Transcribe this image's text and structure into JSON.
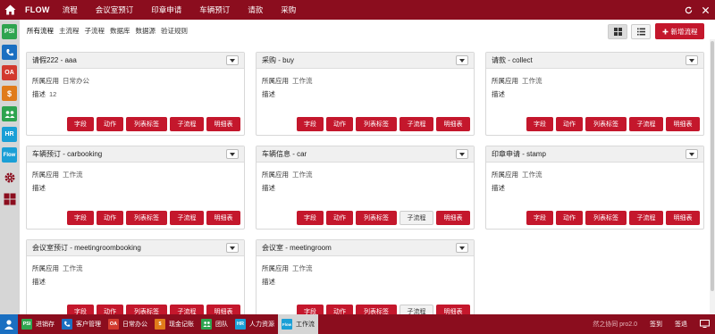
{
  "topbar": {
    "brand": "FLOW",
    "nav": [
      "流程",
      "会议室预订",
      "印章申请",
      "车辆预订",
      "请款",
      "采购"
    ]
  },
  "dock": [
    {
      "label": "PSI",
      "color": "#2ea44f"
    },
    {
      "label": "",
      "icon": "phone-icon",
      "color": "#1a6fc1"
    },
    {
      "label": "OA",
      "color": "#d23a2e"
    },
    {
      "label": "$",
      "color": "#e07b1a"
    },
    {
      "label": "",
      "icon": "team-icon",
      "color": "#2ea44f"
    },
    {
      "label": "HR",
      "color": "#1a9fd6"
    },
    {
      "label": "Flow",
      "color": "#1a9fd6"
    },
    {
      "label": "",
      "icon": "gear-icon",
      "color": "transparent"
    },
    {
      "label": "",
      "icon": "grid-icon",
      "color": "transparent"
    }
  ],
  "subnav": [
    "所有流程",
    "主流程",
    "子流程",
    "数据库",
    "数据源",
    "验证规则"
  ],
  "new_flow_label": "新增流程",
  "labels": {
    "app": "所属应用",
    "desc": "描述",
    "btn_field": "字段",
    "btn_action": "动作",
    "btn_list": "列表标签",
    "btn_sub": "子流程",
    "btn_detail": "明细表"
  },
  "cards": [
    {
      "title": "请假222 - aaa",
      "app": "日常办公",
      "desc": "12"
    },
    {
      "title": "采购 - buy",
      "app": "工作流",
      "desc": ""
    },
    {
      "title": "请款 - collect",
      "app": "工作流",
      "desc": ""
    },
    {
      "title": "车辆预订 - carbooking",
      "app": "工作流",
      "desc": ""
    },
    {
      "title": "车辆信息 - car",
      "app": "工作流",
      "desc": ""
    },
    {
      "title": "印章申请 - stamp",
      "app": "工作流",
      "desc": ""
    },
    {
      "title": "会议室预订 - meetingroombooking",
      "app": "工作流",
      "desc": ""
    },
    {
      "title": "会议室 - meetingroom",
      "app": "工作流",
      "desc": ""
    }
  ],
  "taskbar": {
    "items": [
      {
        "label": "进销存",
        "tag": "PSI",
        "color": "#2ea44f"
      },
      {
        "label": "客户管理",
        "tag": "",
        "color": "#1a6fc1"
      },
      {
        "label": "日常办公",
        "tag": "OA",
        "color": "#d23a2e"
      },
      {
        "label": "现金记账",
        "tag": "$",
        "color": "#e07b1a"
      },
      {
        "label": "团队",
        "tag": "",
        "color": "#2ea44f"
      },
      {
        "label": "人力资源",
        "tag": "HR",
        "color": "#1a9fd6"
      },
      {
        "label": "工作流",
        "tag": "Flow",
        "color": "#1a9fd6"
      }
    ],
    "version": "然之协同 pro2.0",
    "signin": "签到",
    "signout": "签退"
  }
}
